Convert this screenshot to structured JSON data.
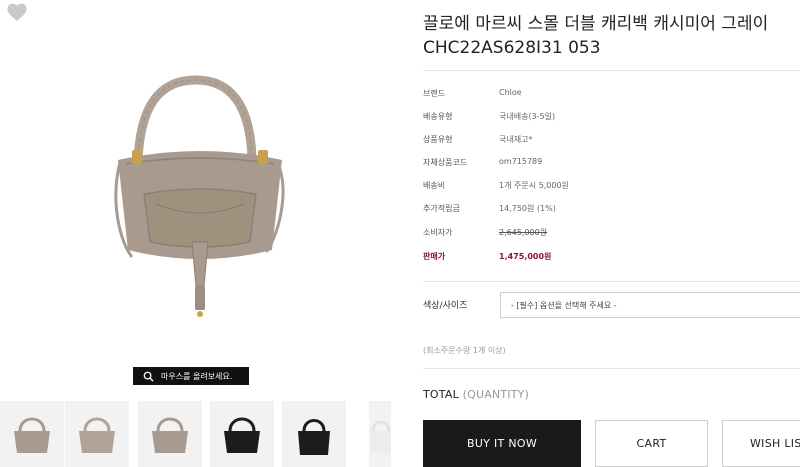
{
  "product": {
    "title": "끌로에 마르씨 스몰 더블 캐리백 캐시미어 그레이 CHC22AS628I31 053"
  },
  "specs": [
    {
      "label": "브랜드",
      "value": "Chloe"
    },
    {
      "label": "배송유형",
      "value": "국내배송(3-5일)"
    },
    {
      "label": "상품유형",
      "value": "국내재고*"
    },
    {
      "label": "자체상품코드",
      "value": "om715789"
    },
    {
      "label": "배송비",
      "value": "1개 주문시 5,000원"
    },
    {
      "label": "추가적립금",
      "value": "14,750원 (1%)"
    },
    {
      "label": "소비자가",
      "value": "2,645,000원"
    },
    {
      "label": "판매가",
      "value": "1,475,000원"
    }
  ],
  "options": {
    "label": "색상/사이즈",
    "placeholder": "- [필수] 옵션을 선택해 주세요 -"
  },
  "min_order_note": "(최소주문수량 1개 이상)",
  "total": {
    "label": "TOTAL",
    "qty": "(QUANTITY)"
  },
  "buttons": {
    "buy": "BUY IT NOW",
    "cart": "CART",
    "wish": "WISH LIST"
  },
  "zoom_hint": "마우스를 올려보세요.",
  "colors": {
    "sale": "#8b1538",
    "dark_button": "#1a1a1a",
    "bag_taupe": "#a89a8e",
    "bag_black": "#1c1c1c"
  },
  "thumbnails": [
    {
      "color": "taupe"
    },
    {
      "color": "taupe"
    },
    {
      "color": "taupe"
    },
    {
      "color": "black"
    },
    {
      "color": "black"
    },
    {
      "color": "white"
    }
  ]
}
